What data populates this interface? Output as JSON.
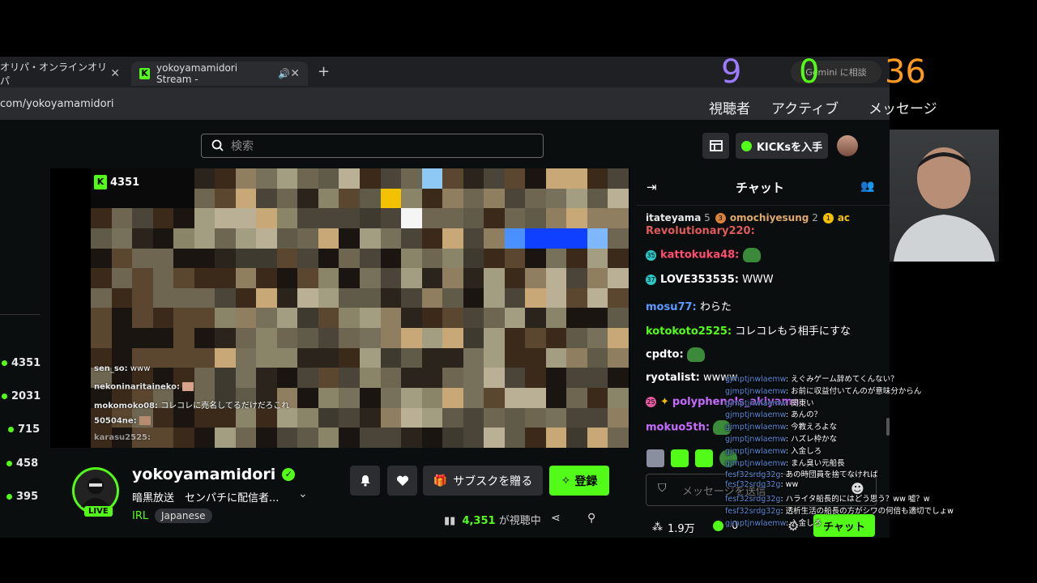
{
  "browser": {
    "tabs": [
      {
        "label": "オリパ・オンラインオリパ"
      },
      {
        "label": "yokoyamamidori Stream -"
      }
    ],
    "url": "com/yokoyamamidori"
  },
  "header": {
    "search_placeholder": "検索",
    "kicks_label": "KICKsを入手"
  },
  "sidebar": {
    "viewer_counts": [
      "4351",
      "2031",
      "715",
      "458",
      "395"
    ]
  },
  "video": {
    "viewer_badge": "4351",
    "overlay_chat": [
      {
        "user": "sen_so:",
        "text": "www"
      },
      {
        "user": "nekoninaritaineko:",
        "text": ""
      },
      {
        "user": "mokomoko08:",
        "text": "コレコレに売名してるだけだろこれ"
      },
      {
        "user": "50504ne:",
        "text": ""
      },
      {
        "user": "karasu2525:",
        "text": ""
      }
    ]
  },
  "streamer": {
    "name": "yokoyamamidori",
    "live_label": "LIVE",
    "title": "暗黒放送　センパチに配信者...",
    "category": "IRL",
    "tag": "Japanese",
    "gift_sub_label": "サブスクを贈る",
    "subscribe_label": "登録",
    "viewer_count": "4,351",
    "viewer_suffix": "が視聴中"
  },
  "chat": {
    "title": "チャット",
    "gifters": [
      {
        "name": "itateyama",
        "count": "5"
      },
      {
        "name": "omochiyesung",
        "count": "2"
      },
      {
        "name": "ac",
        "count": ""
      }
    ],
    "messages": [
      {
        "user": "Revolutionary220:",
        "text": "",
        "color": "#e05a5a",
        "badge": ""
      },
      {
        "user": "kattokuka48:",
        "text": "",
        "color": "#ff4d6d",
        "badge": "35"
      },
      {
        "user": "LOVE353535:",
        "text": "WWW",
        "color": "#ffffff",
        "badge": "37"
      },
      {
        "user": "mosu77:",
        "text": "わらた",
        "color": "#5b9bff",
        "badge": ""
      },
      {
        "user": "kotokoto2525:",
        "text": "コレコレもう相手にすな",
        "color": "#53fc18",
        "badge": ""
      },
      {
        "user": "cpdto:",
        "text": "",
        "color": "#ffffff",
        "badge": ""
      },
      {
        "user": "ryotalist:",
        "text": "wwww",
        "color": "#ffffff",
        "badge": ""
      },
      {
        "user": "polyphenols_akiyama",
        "text": "",
        "color": "#c76bff",
        "badge": "25"
      },
      {
        "user": "mokuo5th:",
        "text": "",
        "color": "#c76bff",
        "badge": ""
      }
    ],
    "input_placeholder": "メッセージを送信",
    "followers": "1.9万",
    "kicks_count": "0",
    "send_label": "チャット"
  },
  "stream_overlay": {
    "gemini_label": "Gemini に相談",
    "stats": [
      {
        "value": "9",
        "label": "視聴者",
        "color": "#9b7bff"
      },
      {
        "value": "0",
        "label": "アクティブ",
        "color": "#53fc18"
      },
      {
        "value": "36",
        "label": "メッセージ",
        "color": "#ff9a1f"
      }
    ],
    "comments": [
      {
        "user": "gjmptjnwlaemw",
        "text": ": えぐみゲーム辞めてくんない？"
      },
      {
        "user": "gjmptjnwlaemw",
        "text": ": お前に収益付いてんのが意味分からん"
      },
      {
        "user": "gjmptjnwlaemw",
        "text": ": 関東い"
      },
      {
        "user": "gjmptjnwlaemw",
        "text": ": あんの？"
      },
      {
        "user": "gjmptjnwlaemw",
        "text": ": 今教えろよな"
      },
      {
        "user": "gjmptjnwlaemw",
        "text": ": ハズレ枠かな"
      },
      {
        "user": "gjmptjnwlaemw",
        "text": ": 入金しろ"
      },
      {
        "user": "gjmptjnwlaemw",
        "text": ": まん臭い元船長"
      },
      {
        "user": "fesf32srdg32g",
        "text": ": あの時団員を捨てなければ"
      },
      {
        "user": "fesf32srdg32g",
        "text": ": ww"
      },
      {
        "user": "fesf32srdg32g",
        "text": ": ハライタ船長的にはどう思う？ww 嘘？w"
      },
      {
        "user": "fesf32srdg32g",
        "text": ": 透析生活の船長の方がシワの何倍も適切でしょw"
      },
      {
        "user": "gjmptjnwlaemw",
        "text": ": 入金しろ"
      }
    ]
  }
}
